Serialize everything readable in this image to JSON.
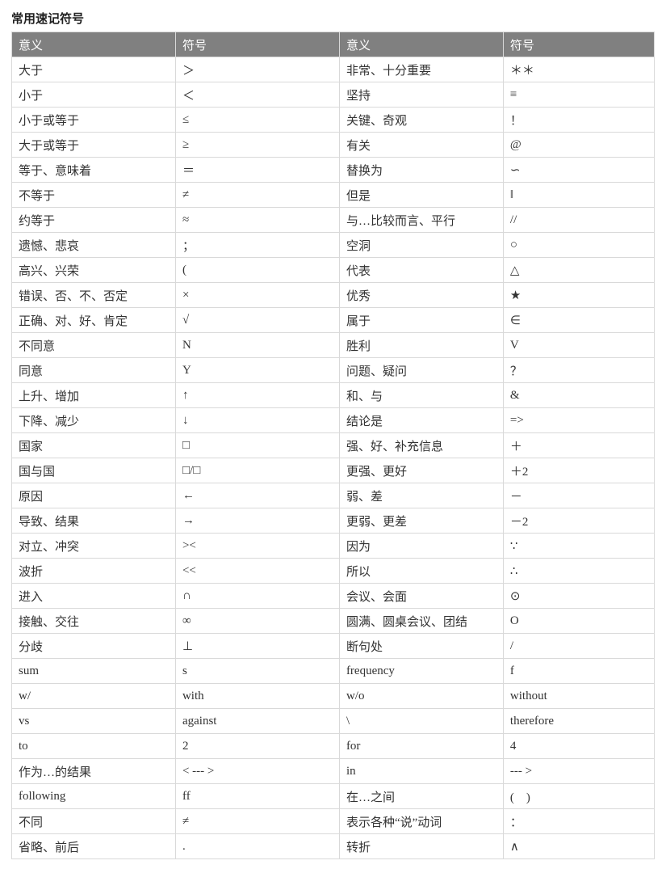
{
  "title": "常用速记符号",
  "headers": [
    "意义",
    "符号",
    "意义",
    "符号"
  ],
  "rows": [
    [
      "大于",
      "＞",
      "非常、十分重要",
      "＊＊"
    ],
    [
      "小于",
      "＜",
      "坚持",
      "≡"
    ],
    [
      "小于或等于",
      "≤",
      "关键、奇观",
      "！"
    ],
    [
      "大于或等于",
      "≥",
      "有关",
      "@"
    ],
    [
      "等于、意味着",
      "＝",
      "替换为",
      "∽"
    ],
    [
      "不等于",
      "≠",
      "但是",
      "‖"
    ],
    [
      "约等于",
      "≈",
      "与…比较而言、平行",
      "//"
    ],
    [
      "遗憾、悲哀",
      "；",
      "空洞",
      "○"
    ],
    [
      "高兴、兴荣",
      "(",
      "代表",
      "△"
    ],
    [
      "错误、否、不、否定",
      "×",
      "优秀",
      "★"
    ],
    [
      "正确、对、好、肯定",
      "√",
      "属于",
      "∈"
    ],
    [
      "不同意",
      "N",
      "胜利",
      "V"
    ],
    [
      "同意",
      "Y",
      "问题、疑问",
      "？"
    ],
    [
      "上升、增加",
      "↑",
      "和、与",
      "&"
    ],
    [
      "下降、减少",
      "↓",
      "结论是",
      "=>"
    ],
    [
      "国家",
      "□",
      "强、好、补充信息",
      "＋"
    ],
    [
      "国与国",
      "□/□",
      "更强、更好",
      "＋2"
    ],
    [
      "原因",
      "←",
      "弱、差",
      "－"
    ],
    [
      "导致、结果",
      "→",
      "更弱、更差",
      "－2"
    ],
    [
      "对立、冲突",
      "><",
      "因为",
      "∵"
    ],
    [
      "波折",
      "<<",
      "所以",
      "∴"
    ],
    [
      "进入",
      "∩",
      "会议、会面",
      "⊙"
    ],
    [
      "接触、交往",
      "∞",
      "圆满、圆桌会议、团结",
      "O"
    ],
    [
      "分歧",
      "⊥",
      "断句处",
      "/"
    ],
    [
      "sum",
      "s",
      "frequency",
      "f"
    ],
    [
      "w/",
      "with",
      "w/o",
      "without"
    ],
    [
      "vs",
      "against",
      "\\",
      "therefore"
    ],
    [
      "to",
      "2",
      "for",
      "4"
    ],
    [
      "作为…的结果",
      "< --- >",
      "in",
      "--- >"
    ],
    [
      "following",
      "ff",
      "在…之间",
      "(　)"
    ],
    [
      "不同",
      "≠",
      "表示各种“说”动词",
      "："
    ],
    [
      "省略、前后",
      ".",
      "转折",
      "∧"
    ]
  ]
}
